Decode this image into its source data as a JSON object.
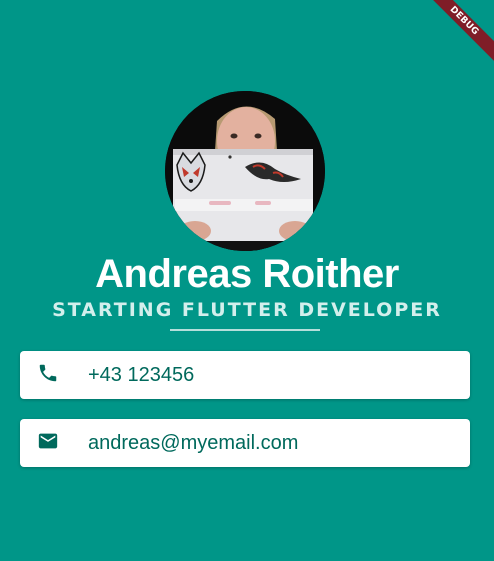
{
  "debug_banner": {
    "label": "DEBUG",
    "color": "#7f1d27"
  },
  "profile": {
    "name": "Andreas Roither",
    "title": "STARTING FLUTTER DEVELOPER"
  },
  "contact": {
    "phone": {
      "icon": "phone-icon",
      "value": "+43 123456"
    },
    "email": {
      "icon": "mail-icon",
      "value": "andreas@myemail.com"
    }
  },
  "colors": {
    "background": "#009688",
    "card": "#ffffff",
    "text_primary": "#ffffff",
    "text_secondary": "#d3efec",
    "accent": "#00695c"
  }
}
